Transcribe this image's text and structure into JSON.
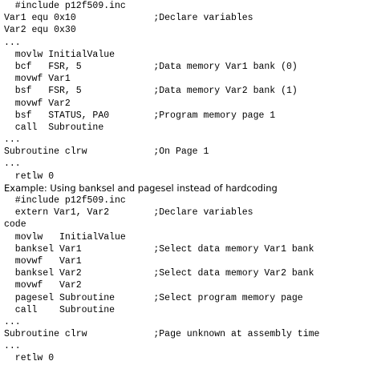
{
  "lines": [
    {
      "code": "  #include p12f509.inc",
      "comment": ""
    },
    {
      "code": "Var1 equ 0x10",
      "comment": ";Declare variables"
    },
    {
      "code": "Var2 equ 0x30",
      "comment": ""
    },
    {
      "code": "...",
      "comment": ""
    },
    {
      "code": "  movlw InitialValue",
      "comment": ""
    },
    {
      "code": "  bcf   FSR, 5",
      "comment": ";Data memory Var1 bank (0)"
    },
    {
      "code": "  movwf Var1",
      "comment": ""
    },
    {
      "code": "  bsf   FSR, 5",
      "comment": ";Data memory Var2 bank (1)"
    },
    {
      "code": "  movwf Var2",
      "comment": ""
    },
    {
      "code": "  bsf   STATUS, PA0",
      "comment": ";Program memory page 1"
    },
    {
      "code": "  call  Subroutine",
      "comment": ""
    },
    {
      "code": "...",
      "comment": ""
    },
    {
      "code": "Subroutine clrw",
      "comment": ";On Page 1"
    },
    {
      "code": "...",
      "comment": ""
    },
    {
      "code": "  retlw 0",
      "comment": ""
    },
    {
      "prose": "Example: Using banksel and pagesel instead of hardcoding"
    },
    {
      "code": "  #include p12f509.inc",
      "comment": ""
    },
    {
      "code": "  extern Var1, Var2",
      "comment": ";Declare variables"
    },
    {
      "code": "code",
      "comment": ""
    },
    {
      "code": "  movlw   InitialValue",
      "comment": ""
    },
    {
      "code": "  banksel Var1",
      "comment": ";Select data memory Var1 bank"
    },
    {
      "code": "  movwf   Var1",
      "comment": ""
    },
    {
      "code": "  banksel Var2",
      "comment": ";Select data memory Var2 bank"
    },
    {
      "code": "  movwf   Var2",
      "comment": ""
    },
    {
      "code": "  pagesel Subroutine",
      "comment": ";Select program memory page"
    },
    {
      "code": "  call    Subroutine",
      "comment": ""
    },
    {
      "code": "...",
      "comment": ""
    },
    {
      "code": "Subroutine clrw",
      "comment": ";Page unknown at assembly time"
    },
    {
      "code": "...",
      "comment": ""
    },
    {
      "code": "  retlw 0",
      "comment": ""
    }
  ]
}
